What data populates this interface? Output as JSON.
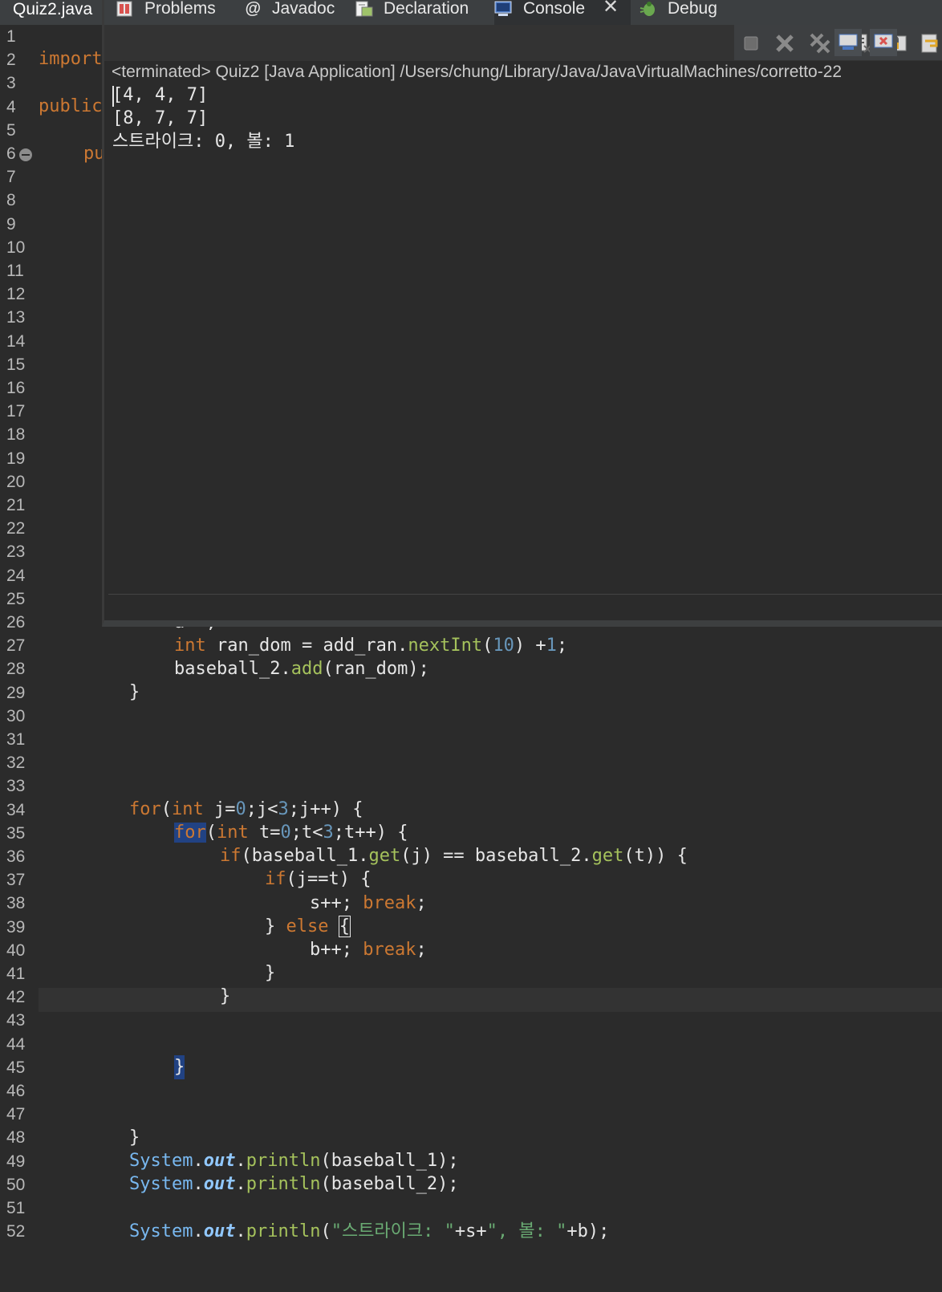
{
  "editor": {
    "tab_label": "Quiz2.java",
    "line_numbers": [
      "1",
      "2",
      "3",
      "4",
      "5",
      "6",
      "7",
      "8",
      "9",
      "10",
      "11",
      "12",
      "13",
      "14",
      "15",
      "16",
      "17",
      "18",
      "19",
      "20",
      "21",
      "22",
      "23",
      "24",
      "25",
      "26",
      "27",
      "28",
      "29",
      "30",
      "31",
      "32",
      "33",
      "34",
      "35",
      "36",
      "37",
      "38",
      "39",
      "40",
      "41",
      "42",
      "43",
      "44",
      "45",
      "46",
      "47",
      "48",
      "49",
      "50",
      "51",
      "52"
    ],
    "partial": {
      "import_fragment": "import",
      "public_fragment": "public",
      "method_fragment": "pu"
    },
    "code": {
      "l26": "a++;",
      "l27": {
        "kw": "int",
        "var": " ran_dom = add_ran.",
        "meth": "nextInt",
        "p1": "(",
        "n1": "10",
        "p2": ") +",
        "n2": "1",
        "p3": ";"
      },
      "l28": {
        "a": "baseball_2.",
        "meth": "add",
        "b": "(ran_dom);"
      },
      "l29": "}",
      "l34": {
        "kw": "for",
        "a": "(",
        "kw2": "int",
        "b": " j=",
        "n1": "0",
        "c": ";j<",
        "n2": "3",
        "d": ";j++) {"
      },
      "l35": {
        "kw": "for",
        "a": "(",
        "kw2": "int",
        "b": " t=",
        "n1": "0",
        "c": ";t<",
        "n2": "3",
        "d": ";t++) {"
      },
      "l36": {
        "kw": "if",
        "a": "(baseball_1.",
        "m1": "get",
        "b": "(j) == baseball_2.",
        "m2": "get",
        "c": "(t)) {"
      },
      "l37": {
        "kw": "if",
        "a": "(j==t) {"
      },
      "l38": {
        "a": "s++; ",
        "kw": "break",
        "b": ";"
      },
      "l39": {
        "a": "} ",
        "kw": "else",
        "b": " ",
        "br": "{"
      },
      "l40": {
        "a": "b++; ",
        "kw": "break",
        "b": ";"
      },
      "l41": "}",
      "l42": "}",
      "l45": "}",
      "l48": "}",
      "l49": {
        "cls": "System",
        "dot": ".",
        "field": "out",
        "dot2": ".",
        "meth": "println",
        "rest": "(baseball_1);"
      },
      "l50": {
        "cls": "System",
        "dot": ".",
        "field": "out",
        "dot2": ".",
        "meth": "println",
        "rest": "(baseball_2);"
      },
      "l52": {
        "cls": "System",
        "dot": ".",
        "field": "out",
        "dot2": ".",
        "meth": "println",
        "p": "(",
        "s1": "\"스트라이크: \"",
        "m": "+s+",
        "s2": "\", 볼: \"",
        "e": "+b);"
      }
    }
  },
  "console": {
    "tabs": [
      {
        "label": "Problems",
        "icon": "problems-icon"
      },
      {
        "label": "Javadoc",
        "icon": "javadoc-icon"
      },
      {
        "label": "Declaration",
        "icon": "declaration-icon"
      },
      {
        "label": "Console",
        "icon": "console-icon"
      },
      {
        "label": "Debug",
        "icon": "debug-icon"
      }
    ],
    "status": "<terminated> Quiz2 [Java Application] /Users/chung/Library/Java/JavaVirtualMachines/corretto-22",
    "output": [
      "[4, 4, 7]",
      "[8, 7, 7]",
      "스트라이크: 0, 볼: 1"
    ],
    "colors": {
      "active_tab_underline": "#3a7bd5",
      "background": "#2b2b2b"
    }
  }
}
